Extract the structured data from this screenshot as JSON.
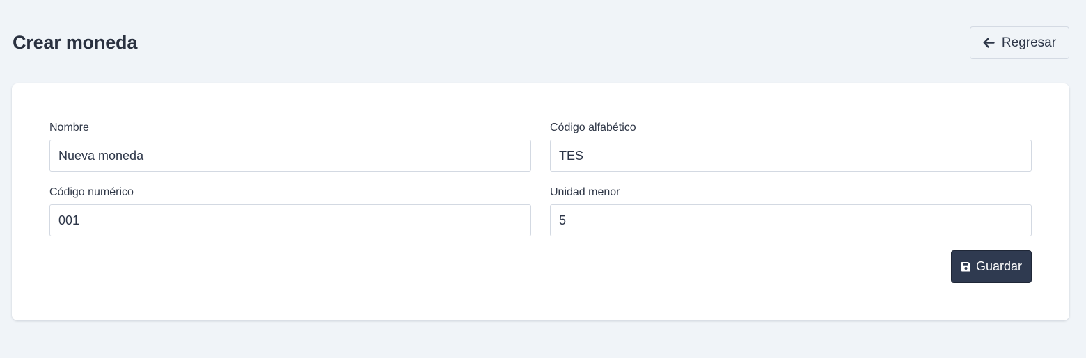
{
  "header": {
    "title": "Crear moneda",
    "back_label": "Regresar"
  },
  "form": {
    "nombre": {
      "label": "Nombre",
      "value": "Nueva moneda"
    },
    "codigo_alfabetico": {
      "label": "Código alfabético",
      "value": "TES"
    },
    "codigo_numerico": {
      "label": "Código numérico",
      "value": "001"
    },
    "unidad_menor": {
      "label": "Unidad menor",
      "value": "5"
    },
    "save_label": "Guardar"
  },
  "icons": {
    "back": "arrow-left-icon",
    "save": "floppy-disk-icon"
  },
  "colors": {
    "background": "#f0f4f8",
    "card": "#ffffff",
    "primary_button": "#2f3a50",
    "text": "#2d3648"
  }
}
